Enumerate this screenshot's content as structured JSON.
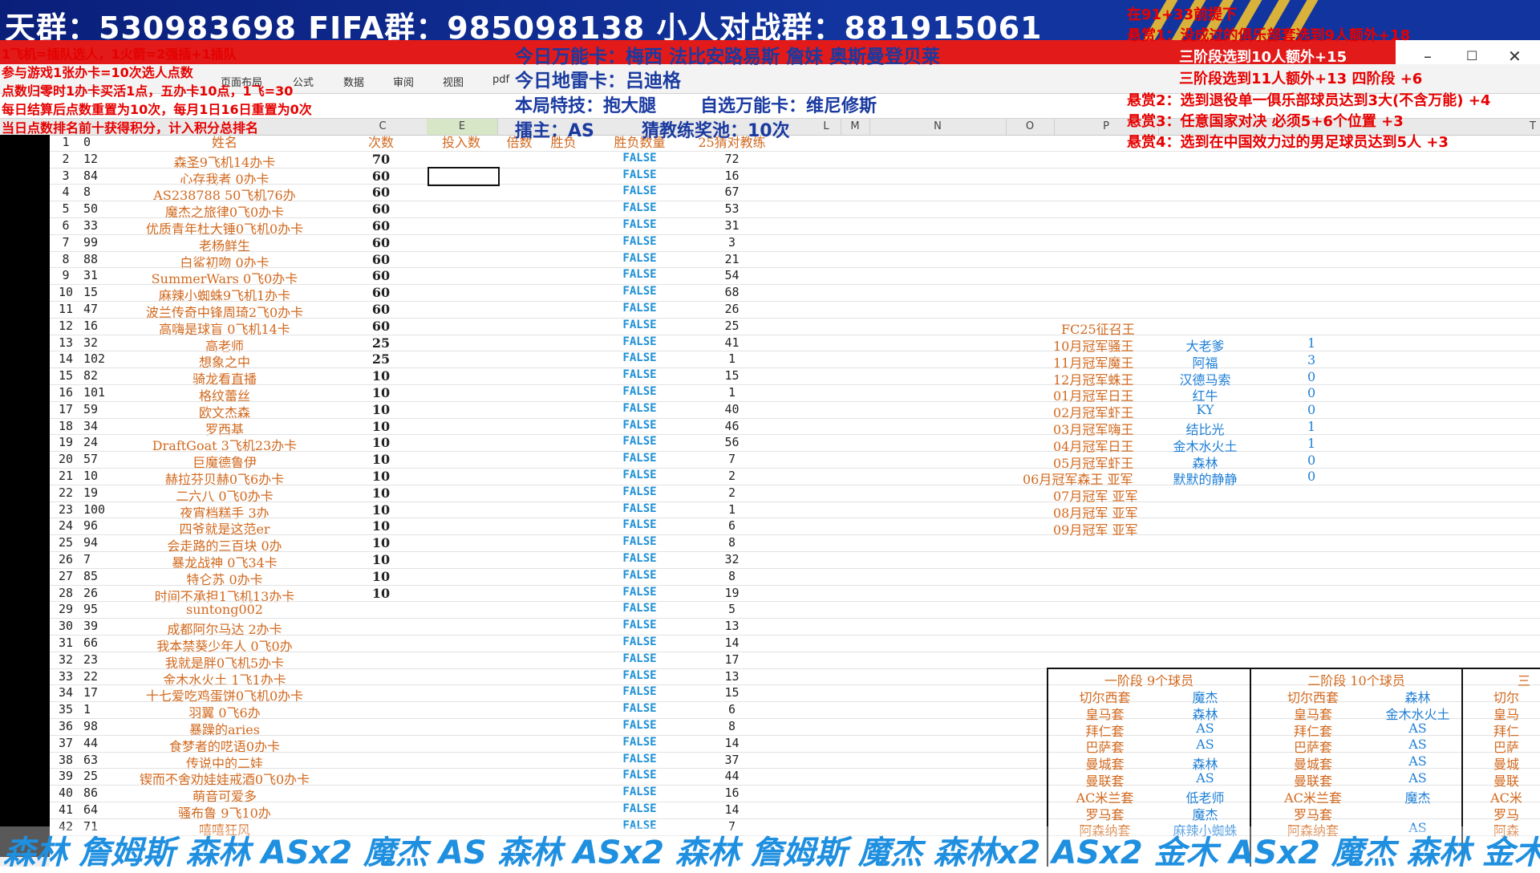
{
  "banner": {
    "groups_text": "天群：530983698   FIFA群：985098138   小人对战群：881915061"
  },
  "left_rules": [
    "1飞机=插队选人，1火箭=2强插+1插队",
    "参与游戏1张办卡=10次选人点数",
    "点数归零时1办卡买活1点，五办卡10点，1飞=30",
    "每日结算后点数重置为10次，每月1日16日重置为0次",
    "当日点数排名前十获得积分，计入积分总排名"
  ],
  "center_info": {
    "wanneng": "今日万能卡：梅西 法比安路易斯 詹妹 奥斯曼登贝莱",
    "dilei": "今日地雷卡：吕迪格",
    "teji": "本局特技：抱大腿",
    "zixuan": "自选万能卡：维尼修斯",
    "host": "擂主：AS",
    "pool": "猜教练奖池：10次"
  },
  "bounties": [
    "在91+33前提下",
    "悬赏1：没成过的俱乐部套选到9人额外+18",
    "三阶段选到10人额外+15",
    "三阶段选到11人额外+13  四阶段 +6",
    "悬赏2：选到退役单一俱乐部球员达到3大(不含万能)  +4",
    "悬赏3：任意国家对决 必须5+6个位置 +3",
    "悬赏4：选到在中国效力过的男足球员达到5人 +3"
  ],
  "ribbon_tabs": [
    "页面布局",
    "公式",
    "数据",
    "审阅",
    "视图",
    "pdf"
  ],
  "col_headers": [
    "C",
    "E",
    "L",
    "M",
    "N",
    "O",
    "P",
    "T"
  ],
  "table_headers": {
    "name": "姓名",
    "count": "次数",
    "input": "投入数",
    "multiplier": "倍数",
    "winlose": "胜负",
    "winlose_count": "胜负数量",
    "guess": "25猜对教练"
  },
  "rows": [
    {
      "r": "1",
      "n": "0",
      "name": "",
      "count": "",
      "bool": "",
      "guess": ""
    },
    {
      "r": "2",
      "n": "12",
      "name": "森圣9飞机14办卡",
      "count": "70",
      "bool": "FALSE",
      "guess": "72"
    },
    {
      "r": "3",
      "n": "84",
      "name": "心存我者 0办卡",
      "count": "60",
      "bool": "FALSE",
      "guess": "16"
    },
    {
      "r": "4",
      "n": "8",
      "name": "AS238788 50飞机76办",
      "count": "60",
      "bool": "FALSE",
      "guess": "67"
    },
    {
      "r": "5",
      "n": "50",
      "name": "魔杰之旅律0飞0办卡",
      "count": "60",
      "bool": "FALSE",
      "guess": "53"
    },
    {
      "r": "6",
      "n": "33",
      "name": "优质青年杜大锤0飞机0办卡",
      "count": "60",
      "bool": "FALSE",
      "guess": "31"
    },
    {
      "r": "7",
      "n": "99",
      "name": "老杨鲜生",
      "count": "60",
      "bool": "FALSE",
      "guess": "3"
    },
    {
      "r": "8",
      "n": "88",
      "name": "白鲨初吻 0办卡",
      "count": "60",
      "bool": "FALSE",
      "guess": "21"
    },
    {
      "r": "9",
      "n": "31",
      "name": "SummerWars 0飞0办卡",
      "count": "60",
      "bool": "FALSE",
      "guess": "54"
    },
    {
      "r": "10",
      "n": "15",
      "name": "麻辣小蜘蛛9飞机1办卡",
      "count": "60",
      "bool": "FALSE",
      "guess": "68"
    },
    {
      "r": "11",
      "n": "47",
      "name": "波兰传奇中锋周琦2飞0办卡",
      "count": "60",
      "bool": "FALSE",
      "guess": "26"
    },
    {
      "r": "12",
      "n": "16",
      "name": "高嗨是球盲 0飞机14卡",
      "count": "60",
      "bool": "FALSE",
      "guess": "25"
    },
    {
      "r": "13",
      "n": "32",
      "name": "高老师",
      "count": "25",
      "bool": "FALSE",
      "guess": "41"
    },
    {
      "r": "14",
      "n": "102",
      "name": "想象之中",
      "count": "25",
      "bool": "FALSE",
      "guess": "1"
    },
    {
      "r": "15",
      "n": "82",
      "name": "骑龙看直播",
      "count": "10",
      "bool": "FALSE",
      "guess": "15"
    },
    {
      "r": "16",
      "n": "101",
      "name": "格纹蕾丝",
      "count": "10",
      "bool": "FALSE",
      "guess": "1"
    },
    {
      "r": "17",
      "n": "59",
      "name": "欧文杰森",
      "count": "10",
      "bool": "FALSE",
      "guess": "40"
    },
    {
      "r": "18",
      "n": "34",
      "name": "罗西基",
      "count": "10",
      "bool": "FALSE",
      "guess": "46"
    },
    {
      "r": "19",
      "n": "24",
      "name": "DraftGoat 3飞机23办卡",
      "count": "10",
      "bool": "FALSE",
      "guess": "56"
    },
    {
      "r": "20",
      "n": "57",
      "name": "巨魔德鲁伊",
      "count": "10",
      "bool": "FALSE",
      "guess": "7"
    },
    {
      "r": "21",
      "n": "10",
      "name": "赫拉芬贝赫0飞6办卡",
      "count": "10",
      "bool": "FALSE",
      "guess": "2"
    },
    {
      "r": "22",
      "n": "19",
      "name": "二六八 0飞0办卡",
      "count": "10",
      "bool": "FALSE",
      "guess": "2"
    },
    {
      "r": "23",
      "n": "100",
      "name": "夜宵档糕手 3办",
      "count": "10",
      "bool": "FALSE",
      "guess": "1"
    },
    {
      "r": "24",
      "n": "96",
      "name": "四爷就是这范er",
      "count": "10",
      "bool": "FALSE",
      "guess": "6"
    },
    {
      "r": "25",
      "n": "94",
      "name": "会走路的三百块 0办",
      "count": "10",
      "bool": "FALSE",
      "guess": "8"
    },
    {
      "r": "26",
      "n": "7",
      "name": "暴龙战神 0飞34卡",
      "count": "10",
      "bool": "FALSE",
      "guess": "32"
    },
    {
      "r": "27",
      "n": "85",
      "name": "特仑苏 0办卡",
      "count": "10",
      "bool": "FALSE",
      "guess": "8"
    },
    {
      "r": "28",
      "n": "26",
      "name": "时间不承担1飞机13办卡",
      "count": "10",
      "bool": "FALSE",
      "guess": "19"
    },
    {
      "r": "29",
      "n": "95",
      "name": "suntong002",
      "count": "",
      "bool": "FALSE",
      "guess": "5"
    },
    {
      "r": "30",
      "n": "39",
      "name": "成都阿尔马达 2办卡",
      "count": "",
      "bool": "FALSE",
      "guess": "13"
    },
    {
      "r": "31",
      "n": "66",
      "name": "我本禁葵少年人 0飞0办",
      "count": "",
      "bool": "FALSE",
      "guess": "14"
    },
    {
      "r": "32",
      "n": "23",
      "name": "我就是胖0飞机5办卡",
      "count": "",
      "bool": "FALSE",
      "guess": "17"
    },
    {
      "r": "33",
      "n": "22",
      "name": "金木水火土 1飞1办卡",
      "count": "",
      "bool": "FALSE",
      "guess": "13"
    },
    {
      "r": "34",
      "n": "17",
      "name": "十七爱吃鸡蛋饼0飞机0办卡",
      "count": "",
      "bool": "FALSE",
      "guess": "15"
    },
    {
      "r": "35",
      "n": "1",
      "name": "羽翼 0飞6办",
      "count": "",
      "bool": "FALSE",
      "guess": "6"
    },
    {
      "r": "36",
      "n": "98",
      "name": "暴躁的aries",
      "count": "",
      "bool": "FALSE",
      "guess": "8"
    },
    {
      "r": "37",
      "n": "44",
      "name": "食梦者的呓语0办卡",
      "count": "",
      "bool": "FALSE",
      "guess": "14"
    },
    {
      "r": "38",
      "n": "63",
      "name": "传说中的二娃",
      "count": "",
      "bool": "FALSE",
      "guess": "37"
    },
    {
      "r": "39",
      "n": "25",
      "name": "锲而不舍劝娃娃戒酒0飞0办卡",
      "count": "",
      "bool": "FALSE",
      "guess": "44"
    },
    {
      "r": "40",
      "n": "86",
      "name": "萌音可爱多",
      "count": "",
      "bool": "FALSE",
      "guess": "16"
    },
    {
      "r": "41",
      "n": "64",
      "name": "骚布鲁 9飞10办",
      "count": "",
      "bool": "FALSE",
      "guess": "14"
    },
    {
      "r": "42",
      "n": "71",
      "name": "嘻嘻狂风",
      "count": "",
      "bool": "FALSE",
      "guess": "7"
    }
  ],
  "champions": {
    "title": "FC25征召王",
    "entries": [
      {
        "label": "10月冠军骚王",
        "name": "大老爹",
        "val": "1"
      },
      {
        "label": "11月冠军魔王",
        "name": "阿福",
        "val": "3"
      },
      {
        "label": "12月冠军蛛王",
        "name": "汉德马索",
        "val": "0"
      },
      {
        "label": "01月冠军日王",
        "name": "红牛",
        "val": "0"
      },
      {
        "label": "02月冠军虾王",
        "name": "KY",
        "val": "0"
      },
      {
        "label": "03月冠军嗨王",
        "name": "结比光",
        "val": "1"
      },
      {
        "label": "04月冠军日王",
        "name": "金木水火土",
        "val": "1"
      },
      {
        "label": "05月冠军虾王",
        "name": "森林",
        "val": "0"
      },
      {
        "label": "06月冠军森王 亚军",
        "name": "默默的静静",
        "val": "0"
      },
      {
        "label": "07月冠军 亚军",
        "name": "",
        "val": ""
      },
      {
        "label": "08月冠军 亚军",
        "name": "",
        "val": ""
      },
      {
        "label": "09月冠军 亚军",
        "name": "",
        "val": ""
      }
    ]
  },
  "stages": {
    "stage1_title": "一阶段 9个球员",
    "stage2_title": "二阶段 10个球员",
    "stage3_title": "三",
    "stage1_rows": [
      [
        "切尔西套",
        "魔杰"
      ],
      [
        "皇马套",
        "森林"
      ],
      [
        "拜仁套",
        "AS"
      ],
      [
        "巴萨套",
        "AS"
      ],
      [
        "曼城套",
        "森林"
      ],
      [
        "曼联套",
        "AS"
      ],
      [
        "AC米兰套",
        "低老师"
      ],
      [
        "罗马套",
        "魔杰"
      ],
      [
        "阿森纳套",
        "麻辣小蜘蛛"
      ]
    ],
    "stage2_rows": [
      [
        "切尔西套",
        "森林"
      ],
      [
        "皇马套",
        "金木水火土"
      ],
      [
        "拜仁套",
        "AS"
      ],
      [
        "巴萨套",
        "AS"
      ],
      [
        "曼城套",
        "AS"
      ],
      [
        "曼联套",
        "AS"
      ],
      [
        "AC米兰套",
        "魔杰"
      ],
      [
        "罗马套",
        ""
      ],
      [
        "阿森纳套",
        "AS"
      ]
    ],
    "stage3_rows": [
      "切尔",
      "皇马",
      "拜仁",
      "巴萨",
      "曼城",
      "曼联",
      "AC米",
      "罗马",
      "阿森"
    ]
  },
  "ticker": "森林 詹姆斯 森林 ASx2 魔杰 AS 森林 ASx2 森林 詹姆斯 魔杰 森林x2 ASx2 金木 ASx2 魔杰 森林 金木 A"
}
